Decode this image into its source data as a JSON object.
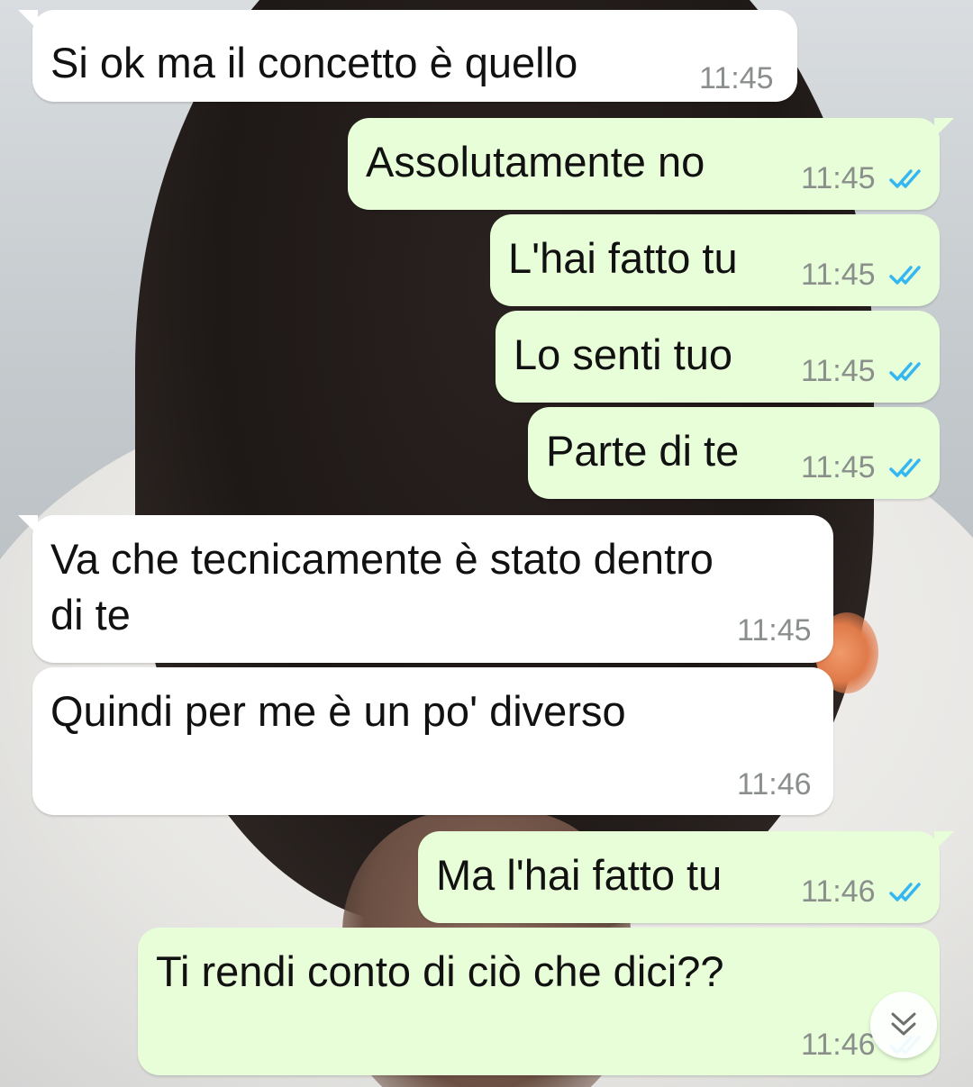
{
  "chat": {
    "messages": [
      {
        "direction": "incoming",
        "text": "Si ok ma il concetto è quello",
        "time": "11:45"
      },
      {
        "direction": "outgoing",
        "text": "Assolutamente no",
        "time": "11:45",
        "status": "read"
      },
      {
        "direction": "outgoing",
        "text": "L'hai fatto tu",
        "time": "11:45",
        "status": "read"
      },
      {
        "direction": "outgoing",
        "text": "Lo senti tuo",
        "time": "11:45",
        "status": "read"
      },
      {
        "direction": "outgoing",
        "text": "Parte di te",
        "time": "11:45",
        "status": "read"
      },
      {
        "direction": "incoming",
        "text_line1": "Va che tecnicamente è stato dentro",
        "text_line2": "di te",
        "time": "11:45"
      },
      {
        "direction": "incoming",
        "text": "Quindi per me è un po' diverso",
        "time": "11:46"
      },
      {
        "direction": "outgoing",
        "text": "Ma l'hai fatto tu",
        "time": "11:46",
        "status": "read"
      },
      {
        "direction": "outgoing",
        "text": "Ti rendi conto di ciò che dici??",
        "time": "11:46",
        "status": "read"
      }
    ]
  },
  "icons": {
    "read_receipt": "double-check-icon",
    "scroll_down": "double-chevron-down-icon"
  },
  "colors": {
    "incoming_bubble": "#ffffff",
    "outgoing_bubble": "#e7fed8",
    "read_tick": "#34b7f1",
    "timestamp": "#8a8f8c"
  }
}
